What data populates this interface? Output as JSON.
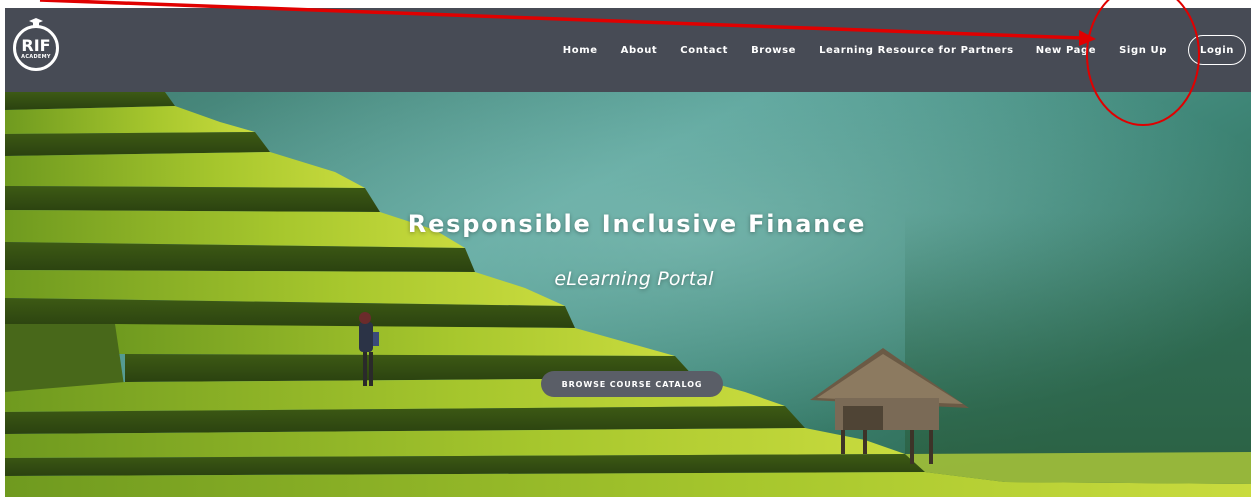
{
  "brand": {
    "logo_text": "RIF",
    "logo_subtext": "ACADEMY"
  },
  "nav": {
    "items": [
      {
        "label": "Home"
      },
      {
        "label": "About"
      },
      {
        "label": "Contact"
      },
      {
        "label": "Browse"
      },
      {
        "label": "Learning Resource for Partners"
      },
      {
        "label": "New Page"
      },
      {
        "label": "Sign Up"
      }
    ],
    "login_label": "Login"
  },
  "hero": {
    "title": "Responsible Inclusive Finance",
    "subtitle": "eLearning Portal",
    "cta_label": "BROWSE COURSE CATALOG"
  },
  "colors": {
    "navbar": "#474b55",
    "annotation_red": "#e00000",
    "cta_bg": "#5a5e67"
  },
  "icons": {
    "logo_cap": "graduation-cap-icon"
  }
}
